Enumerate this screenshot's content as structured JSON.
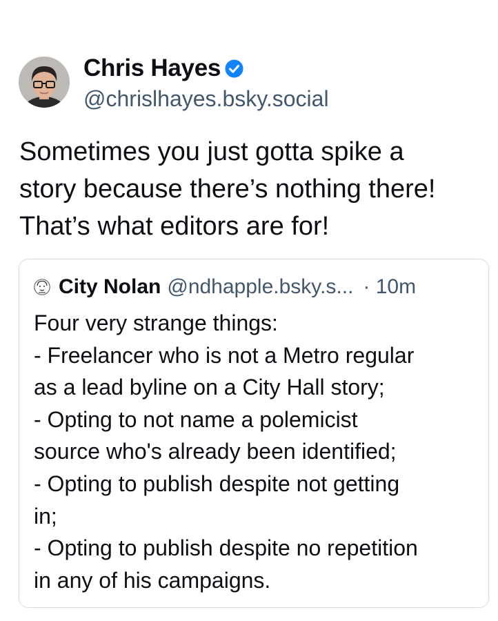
{
  "post": {
    "author": {
      "display_name": "Chris Hayes",
      "handle": "@chrislhayes.bsky.social",
      "verified": true,
      "verified_color": "#1083fe",
      "avatar_icon": "profile-photo"
    },
    "text": "Sometimes you just gotta spike a\nstory because there’s nothing there!\nThat’s what editors are for!"
  },
  "quoted_post": {
    "author": {
      "display_name": "City Nolan",
      "handle": "@ndhapple.bsky.s...",
      "avatar_icon": "sketch-face-avatar"
    },
    "time": "· 10m",
    "text": "Four very strange things:\n - Freelancer who is not a Metro regular\nas a lead byline on a City Hall story;\n - Opting to not name a polemicist\nsource who's already been identified;\n - Opting to publish despite not getting\nin;\n - Opting to publish despite no repetition\nin any of his campaigns."
  },
  "colors": {
    "text_primary": "#0b0f14",
    "text_secondary": "#42576c",
    "card_border": "#d4dbe2",
    "background": "#ffffff"
  }
}
